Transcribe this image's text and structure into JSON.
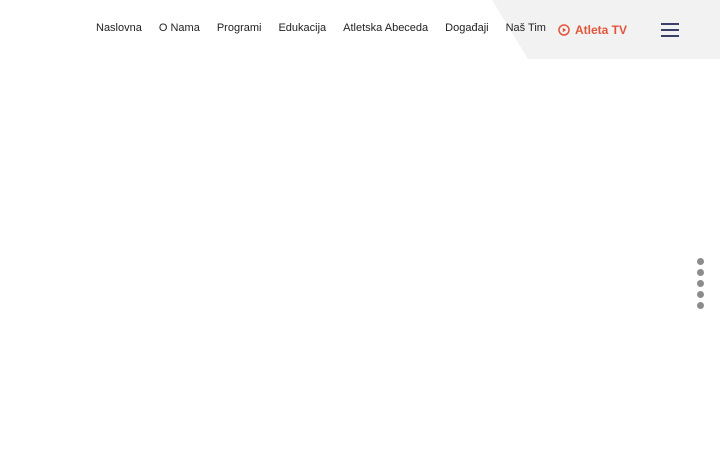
{
  "nav": {
    "items": [
      {
        "label": "Naslovna"
      },
      {
        "label": "O Nama"
      },
      {
        "label": "Programi"
      },
      {
        "label": "Edukacija"
      },
      {
        "label": "Atletska Abeceda"
      },
      {
        "label": "Događaji"
      },
      {
        "label": "Naš Tim"
      }
    ]
  },
  "header": {
    "atleta_tv_label": "Atleta TV",
    "atleta_tv_icon": "play-circle-icon",
    "menu_icon": "hamburger-menu-icon"
  },
  "section_nav": {
    "dot_count": 5
  },
  "colors": {
    "accent": "#e2553b",
    "menu_icon": "#3d3f6b",
    "panel_bg": "#f2f2f2",
    "nav_text": "#222222",
    "dot": "#8c8c8c"
  }
}
